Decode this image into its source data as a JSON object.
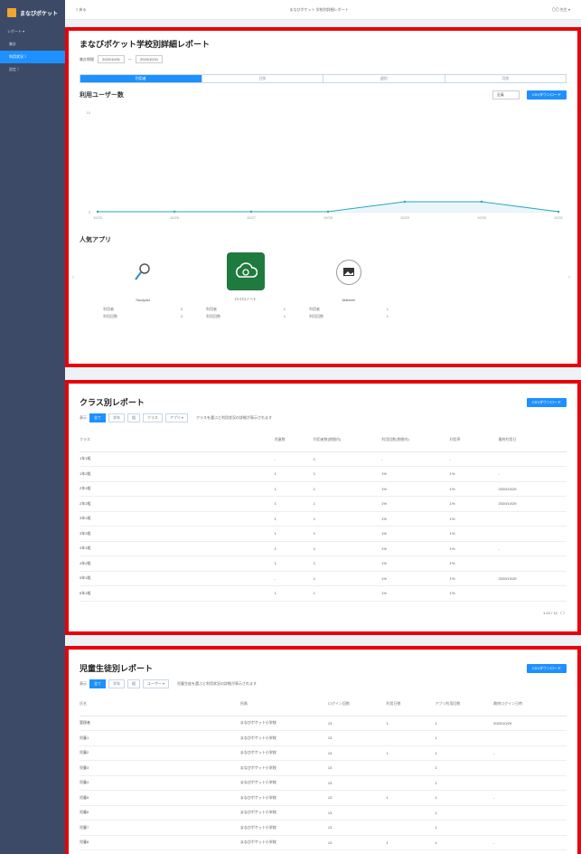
{
  "sidebar": {
    "logo": "まなびポケット",
    "items": [
      {
        "label": "レポート ▾"
      },
      {
        "label": "集計"
      },
      {
        "label": "利用状況 〉"
      },
      {
        "label": "設定 〉"
      }
    ]
  },
  "topbar": {
    "left": "≡ 戻る",
    "center": "まなびポケット 学校別詳細レポート",
    "right": "〇〇 先生 ▾"
  },
  "report": {
    "title": "まなびポケット学校別詳細レポート",
    "period_label": "集計期間",
    "date_from": "2020/10/01",
    "date_to": "2020/10/31",
    "tabs": [
      "利用者",
      "日別",
      "週別",
      "月別"
    ],
    "chart_section_title": "利用ユーザー数",
    "chart_select": "全員",
    "chart_export": "CSVダウンロード",
    "apps_title": "人気アプリ",
    "apps": [
      {
        "name": "Studyaid",
        "icon": "magnifier-icon",
        "stat1_label": "利用者",
        "stat1_value": "3",
        "stat2_label": "利用回数",
        "stat2_value": "3"
      },
      {
        "name": "ロイロノート",
        "icon": "cloud-app-icon",
        "stat1_label": "利用者",
        "stat1_value": "1",
        "stat2_label": "利用回数",
        "stat2_value": "1"
      },
      {
        "name": "Mabeee",
        "icon": "image-app-icon",
        "stat1_label": "利用者",
        "stat1_value": "1",
        "stat2_label": "利用回数",
        "stat2_value": "1"
      }
    ]
  },
  "chart_data": {
    "type": "line",
    "x": [
      "10/25",
      "10/26",
      "10/27",
      "10/28",
      "10/29",
      "10/30",
      "10/31"
    ],
    "series": [
      {
        "values": [
          0,
          0,
          0,
          0,
          1,
          1,
          0
        ]
      }
    ],
    "ylim": [
      0,
      10
    ],
    "y_ticks": [
      "10",
      "0"
    ],
    "grid": false,
    "line_color": "#2aa6b8",
    "fill_color": "#e9f7fa"
  },
  "class_report": {
    "title": "クラス別レポート",
    "export": "CSVダウンロード",
    "filter_label": "表示",
    "chips": [
      "全て",
      "学年",
      "組",
      "クラス",
      "アプリ ▾"
    ],
    "note": "クラスを選ぶと利用状況の詳細が表示されます",
    "headers": [
      "クラス",
      "児童数",
      "利用者数(期間内)",
      "利用回数(期間内)",
      "利用率",
      "最終利用日"
    ],
    "rows": [
      [
        "1年1組",
        "-",
        "1",
        "-",
        "-",
        ""
      ],
      [
        "1年2組",
        "1",
        "1",
        "1%",
        "1%",
        "-"
      ],
      [
        "2年1組",
        "1",
        "1",
        "1%",
        "1%",
        "2020/10/29"
      ],
      [
        "2年2組",
        "1",
        "1",
        "1%",
        "1%",
        "2020/10/29"
      ],
      [
        "3年1組",
        "1",
        "1",
        "1%",
        "1%",
        ""
      ],
      [
        "3年2組",
        "1",
        "1",
        "1%",
        "1%",
        ""
      ],
      [
        "4年1組",
        "1",
        "1",
        "1%",
        "1%",
        "-"
      ],
      [
        "4年2組",
        "1",
        "1",
        "1%",
        "1%",
        ""
      ],
      [
        "5年1組",
        "-",
        "1",
        "1%",
        "1%",
        "2020/10/29"
      ],
      [
        "6年1組",
        "1",
        "1",
        "1%",
        "1%",
        ""
      ]
    ],
    "pager": "1-10 / 12 〈 〉"
  },
  "student_report": {
    "title": "児童生徒別レポート",
    "export": "CSVダウンロード",
    "filter_label": "表示",
    "chips": [
      "全て",
      "学年",
      "組",
      "ユーザー ▾"
    ],
    "note": "児童生徒を選ぶと利用状況の詳細が表示されます",
    "headers": [
      "氏名",
      "所属",
      "ログイン回数",
      "利用日数",
      "アプリ利用回数",
      "最終ログイン日時"
    ],
    "rows": [
      [
        "管理者",
        "まなびポケット小学校",
        "13",
        "1",
        "1",
        "2020/10/29"
      ],
      [
        "児童1",
        "まなびポケット小学校",
        "13",
        "",
        "1",
        ""
      ],
      [
        "児童2",
        "まなびポケット小学校",
        "13",
        "1",
        "1",
        "-"
      ],
      [
        "児童3",
        "まなびポケット小学校",
        "13",
        "",
        "1",
        ""
      ],
      [
        "児童4",
        "まなびポケット小学校",
        "13",
        "",
        "1",
        ""
      ],
      [
        "児童5",
        "まなびポケット小学校",
        "13",
        "1",
        "1",
        "-"
      ],
      [
        "児童6",
        "まなびポケット小学校",
        "13",
        "",
        "1",
        ""
      ],
      [
        "児童7",
        "まなびポケット小学校",
        "13",
        "",
        "1",
        ""
      ],
      [
        "児童8",
        "まなびポケット小学校",
        "13",
        "1",
        "1",
        "-"
      ]
    ]
  }
}
